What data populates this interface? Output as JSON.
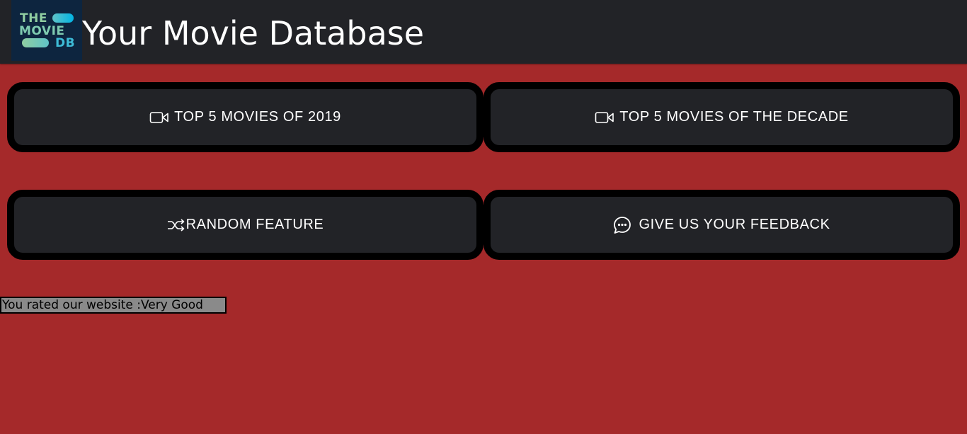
{
  "header": {
    "logo": {
      "line1": "THE",
      "line2": "MOVIE",
      "line3": "DB",
      "colors": {
        "background": "#0d253f",
        "teal": "#90cea1",
        "blue": "#01b4e4"
      }
    },
    "title": "Your Movie Database"
  },
  "buttons": [
    {
      "label": "TOP 5 MOVIES OF 2019",
      "icon": "video-camera-icon"
    },
    {
      "label": "TOP 5 MOVIES OF THE DECADE",
      "icon": "video-camera-icon"
    },
    {
      "label": "RANDOM FEATURE",
      "icon": "shuffle-icon"
    },
    {
      "label": "GIVE US YOUR FEEDBACK",
      "icon": "chat-bubble-icon"
    }
  ],
  "rating": {
    "text": "You rated our website :Very Good"
  },
  "colors": {
    "page_background": "#a5292a",
    "header_background": "#222327",
    "button_background": "#222327",
    "button_border": "#000000",
    "rating_background": "#8a8a8a"
  }
}
